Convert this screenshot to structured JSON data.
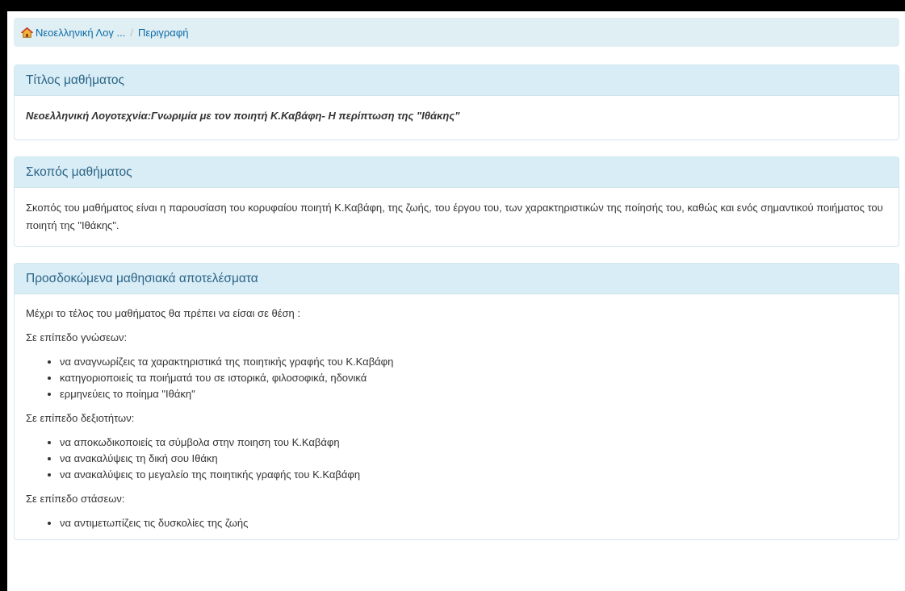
{
  "breadcrumb": {
    "course": "Νεοελληνική Λογ ...",
    "separator": "/",
    "current": "Περιγραφή"
  },
  "sections": {
    "title": {
      "heading": "Τίτλος μαθήματος",
      "text": "Νεοελληνική Λογοτεχνία:Γνωριμία με τον ποιητή Κ.Καβάφη- Η περίπτωση της \"Ιθάκης\""
    },
    "purpose": {
      "heading": "Σκοπός μαθήματος",
      "text": "Σκοπός του μαθήματος είναι η παρουσίαση του κορυφαίου ποιητή Κ.Καβάφη, της ζωής, του έργου του, των χαρακτηριστικών της ποίησής του, καθώς και ενός σημαντικού ποιήματος του ποιητή της \"Ιθάκης\"."
    },
    "outcomes": {
      "heading": "Προσδοκώμενα μαθησιακά αποτελέσματα",
      "intro": "Μέχρι το τέλος του μαθήματος θα πρέπει να είσαι σε θέση :",
      "groups": [
        {
          "label": "Σε επίπεδο γνώσεων:",
          "items": [
            "να αναγνωρίζεις τα χαρακτηριστικά της ποιητικής γραφής του Κ.Καβάφη",
            "κατηγοριοποιείς τα ποιήματά του σε ιστορικά, φιλοσοφικά, ηδονικά",
            "ερμηνεύεις το ποίημα \"Ιθάκη\""
          ]
        },
        {
          "label": "Σε επίπεδο δεξιοτήτων:",
          "items": [
            "να αποκωδικοποιείς τα σύμβολα στην ποιηση του Κ.Καβάφη",
            "να ανακαλύψεις τη δική σου Ιθάκη",
            "να ανακαλύψεις το μεγαλείο της ποιητικής γραφής του Κ.Καβάφη"
          ]
        },
        {
          "label": "Σε επίπεδο στάσεων:",
          "items": [
            "να αντιμετωπίζεις τις δυσκολίες της ζωής"
          ]
        }
      ]
    }
  },
  "colors": {
    "heading_bg": "#d9edf7",
    "heading_text": "#2a6485",
    "breadcrumb_bg": "#dfeff3",
    "link": "#0e6aa8"
  },
  "icons": {
    "home": "home-icon"
  }
}
